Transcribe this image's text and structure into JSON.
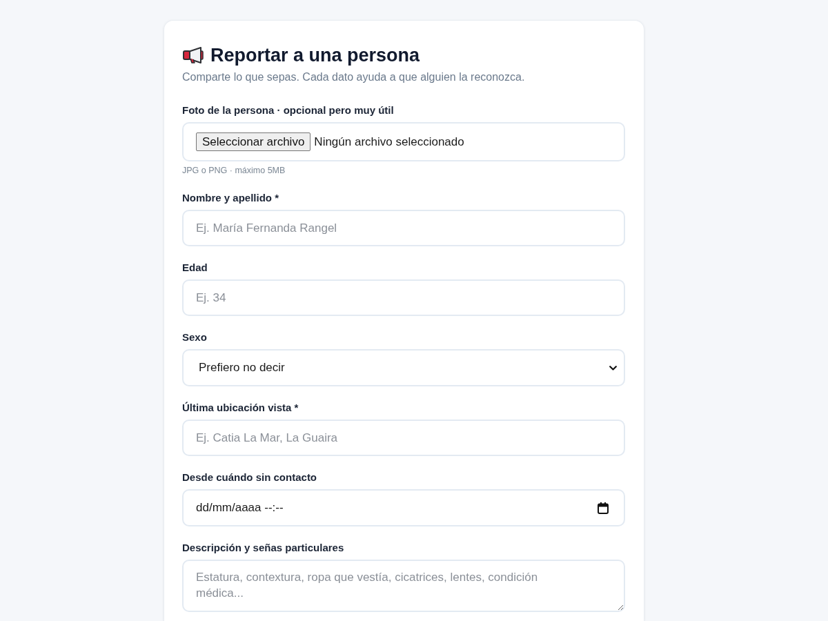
{
  "form": {
    "title": "Reportar a una persona",
    "subtitle": "Comparte lo que sepas. Cada dato ayuda a que alguien la reconozca.",
    "fields": [
      {
        "kind": "file",
        "label": "Foto de la persona · opcional pero muy útil",
        "button": "Seleccionar archivo",
        "status": "Ningún archivo seleccionado",
        "hint": "JPG o PNG · máximo 5MB"
      },
      {
        "kind": "text",
        "label": "Nombre y apellido *",
        "placeholder": "Ej. María Fernanda Rangel"
      },
      {
        "kind": "text",
        "label": "Edad",
        "placeholder": "Ej. 34"
      },
      {
        "kind": "select",
        "label": "Sexo",
        "value": "Prefiero no decir"
      },
      {
        "kind": "text",
        "label": "Última ubicación vista *",
        "placeholder": "Ej. Catia La Mar, La Guaira"
      },
      {
        "kind": "datetime",
        "label": "Desde cuándo sin contacto",
        "placeholder": "dd/mm/aaaa --:--"
      },
      {
        "kind": "textarea",
        "label": "Descripción y señas particulares",
        "placeholder": "Estatura, contextura, ropa que vestía, cicatrices, lentes, condición médica..."
      }
    ]
  }
}
